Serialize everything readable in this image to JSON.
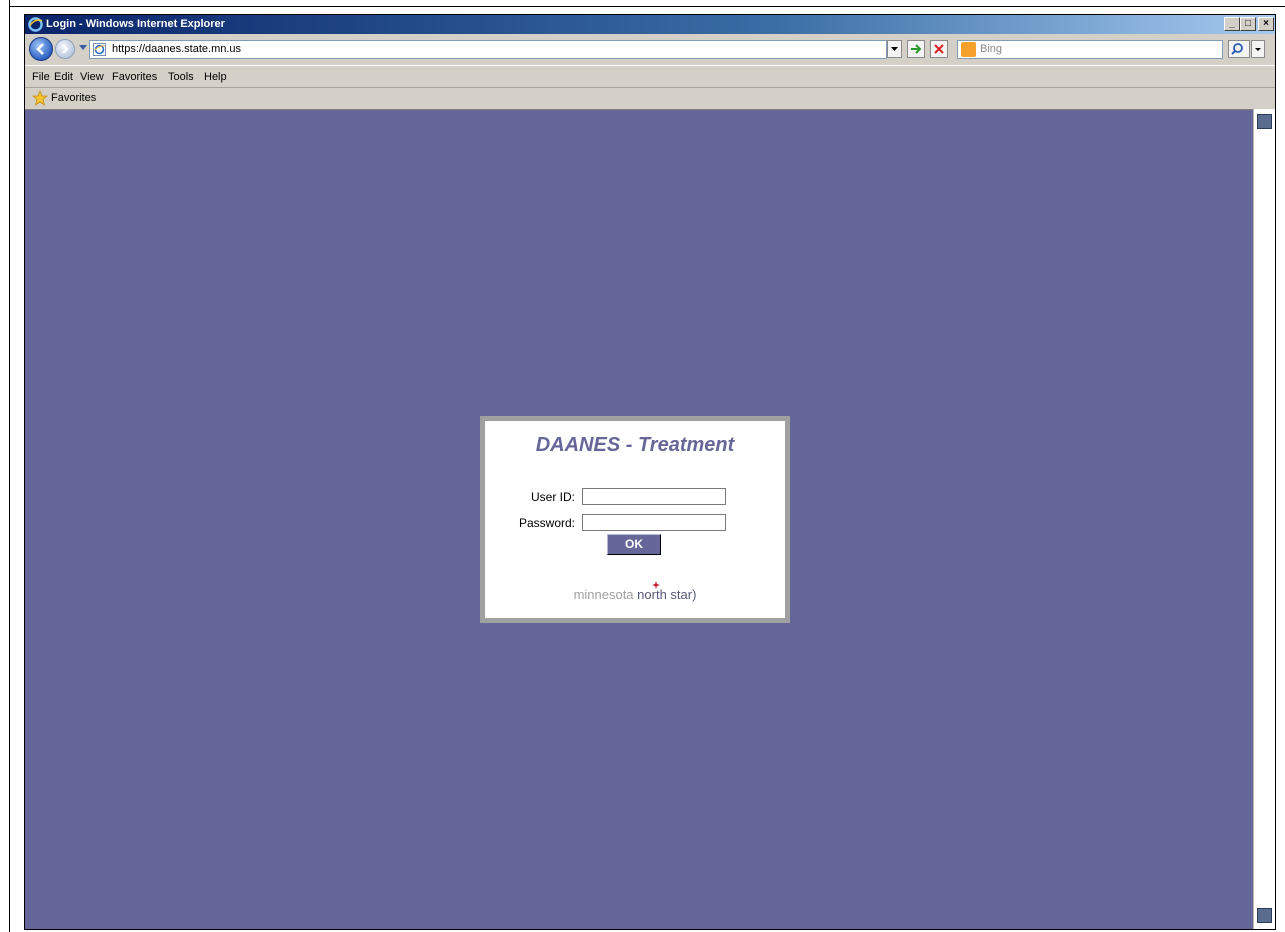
{
  "window": {
    "title": "Login - Windows Internet Explorer",
    "minimize_glyph": "_",
    "maximize_glyph": "□",
    "close_glyph": "×"
  },
  "address_bar": {
    "url": "https://daanes.state.mn.us"
  },
  "search": {
    "placeholder": "Bing"
  },
  "menu": {
    "items": [
      "File",
      "Edit",
      "View",
      "Favorites",
      "Tools",
      "Help"
    ]
  },
  "favorites_bar": {
    "label": "Favorites"
  },
  "login": {
    "title": "DAANES - Treatment",
    "user_id_label": "User ID:",
    "password_label": "Password:",
    "user_id_value": "",
    "password_value": "",
    "ok_label": "OK",
    "logo_text_1": "minnesota",
    "logo_text_2": "north star)"
  },
  "colors": {
    "background": "#666699",
    "title_color": "#666699",
    "button": "#666699"
  },
  "icons": [
    "ie-icon",
    "back-icon",
    "forward-icon",
    "page-icon",
    "go-icon",
    "stop-icon",
    "bing-icon",
    "search-icon",
    "star-icon"
  ]
}
